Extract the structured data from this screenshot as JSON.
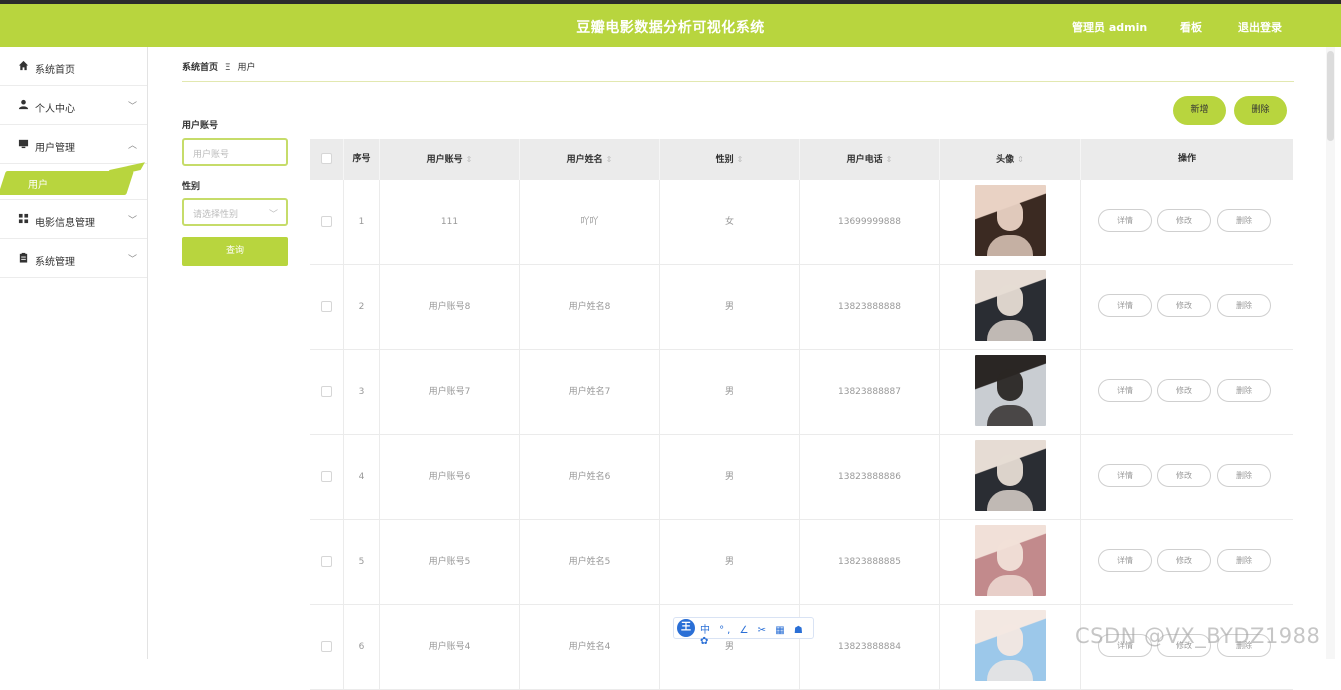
{
  "header": {
    "title": "豆瓣电影数据分析可视化系统",
    "user": "管理员 admin",
    "board": "看板",
    "logout": "退出登录"
  },
  "sidebar": {
    "items": [
      {
        "label": "系统首页",
        "icon": "home-icon"
      },
      {
        "label": "个人中心",
        "icon": "person-icon"
      },
      {
        "label": "用户管理",
        "icon": "monitor-icon"
      },
      {
        "label": "电影信息管理",
        "icon": "grid-icon"
      },
      {
        "label": "系统管理",
        "icon": "clipboard-icon"
      }
    ],
    "active_sub": "用户"
  },
  "breadcrumb": {
    "home": "系统首页",
    "sep": "Ξ",
    "current": "用户"
  },
  "search": {
    "account_label": "用户账号",
    "account_placeholder": "用户账号",
    "gender_label": "性别",
    "gender_placeholder": "请选择性别",
    "query": "查询"
  },
  "actions": {
    "add": "新增",
    "delete": "删除"
  },
  "table": {
    "headers": [
      "序号",
      "用户账号",
      "用户姓名",
      "性别",
      "用户电话",
      "头像",
      "操作"
    ],
    "row_buttons": [
      "详情",
      "修改",
      "删除"
    ],
    "rows": [
      {
        "no": "1",
        "account": "111",
        "name": "吖吖",
        "gender": "女",
        "phone": "13699999888"
      },
      {
        "no": "2",
        "account": "用户账号8",
        "name": "用户姓名8",
        "gender": "男",
        "phone": "13823888888"
      },
      {
        "no": "3",
        "account": "用户账号7",
        "name": "用户姓名7",
        "gender": "男",
        "phone": "13823888887"
      },
      {
        "no": "4",
        "account": "用户账号6",
        "name": "用户姓名6",
        "gender": "男",
        "phone": "13823888886"
      },
      {
        "no": "5",
        "account": "用户账号5",
        "name": "用户姓名5",
        "gender": "男",
        "phone": "13823888885"
      },
      {
        "no": "6",
        "account": "用户账号4",
        "name": "用户姓名4",
        "gender": "男",
        "phone": "13823888884"
      }
    ]
  },
  "ime": {
    "glyph": "王",
    "items": "中 °, ∠ ✂ ▦ ☗ ✿"
  },
  "watermark": "CSDN @VX_BYDZ1988"
}
